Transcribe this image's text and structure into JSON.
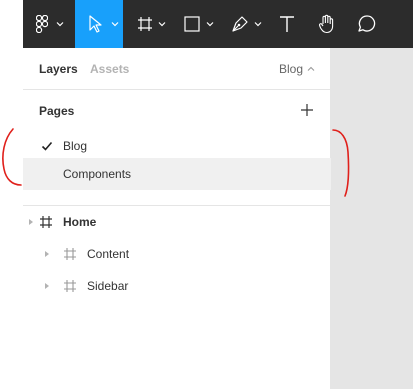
{
  "toolbar": {
    "tools": [
      {
        "name": "main-menu",
        "icon": "figma-logo-icon"
      },
      {
        "name": "move-tool",
        "icon": "cursor-arrow-icon",
        "active": true
      },
      {
        "name": "frame-tool",
        "icon": "hash-frame-icon"
      },
      {
        "name": "shape-tool",
        "icon": "rectangle-icon"
      },
      {
        "name": "pen-tool",
        "icon": "pen-icon"
      },
      {
        "name": "text-tool",
        "icon": "text-T-icon"
      },
      {
        "name": "hand-tool",
        "icon": "hand-icon"
      },
      {
        "name": "comment-tool",
        "icon": "speech-bubble-icon"
      }
    ],
    "colors": {
      "background": "#2c2c2c",
      "active": "#18a0fb",
      "icon": "#ffffff"
    }
  },
  "panel": {
    "tabs": {
      "layers": "Layers",
      "assets": "Assets"
    },
    "current_page_label": "Blog"
  },
  "pages": {
    "title": "Pages",
    "items": [
      {
        "label": "Blog",
        "selected": true
      },
      {
        "label": "Components",
        "selected": false
      }
    ]
  },
  "layers": {
    "items": [
      {
        "label": "Home",
        "type": "frame",
        "level": 0
      },
      {
        "label": "Content",
        "type": "frame",
        "level": 1
      },
      {
        "label": "Sidebar",
        "type": "frame",
        "level": 1
      }
    ]
  },
  "annotation": {
    "color": "#e0201b"
  }
}
